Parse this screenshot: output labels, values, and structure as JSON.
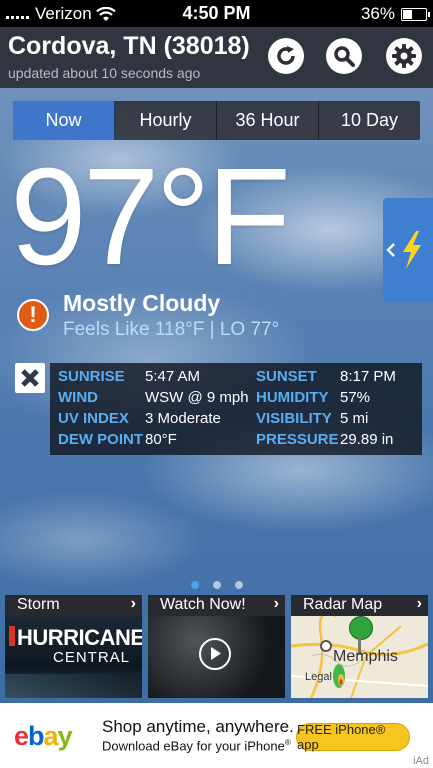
{
  "status_bar": {
    "carrier": "Verizon",
    "time": "4:50 PM",
    "battery": "36%",
    "battery_level": 0.36
  },
  "header": {
    "city": "Cordova, TN (38018)",
    "updated": "updated about 10 seconds ago",
    "buttons": [
      "refresh-icon",
      "search-icon",
      "gear-icon"
    ]
  },
  "tabs": [
    "Now",
    "Hourly",
    "36 Hour",
    "10 Day"
  ],
  "active_tab": "Now",
  "current": {
    "temp": "97°F",
    "condition": "Mostly Cloudy",
    "feels_like": "Feels Like 118°F |  LO 77°"
  },
  "details": {
    "sunrise_label": "SUNRISE",
    "sunrise": "5:47 AM",
    "sunset_label": "SUNSET",
    "sunset": "8:17 PM",
    "wind_label": "WIND",
    "wind": "WSW @ 9 mph",
    "humidity_label": "HUMIDITY",
    "humidity": "57%",
    "uv_label": "UV INDEX",
    "uv": "3 Moderate",
    "visibility_label": "VISIBILITY",
    "visibility": "5 mi",
    "dew_label": "DEW POINT",
    "dew": "80°F",
    "pressure_label": "PRESSURE",
    "pressure": "29.89 in"
  },
  "pager": {
    "pages": 3,
    "active": 0
  },
  "cards": {
    "storm": {
      "title": "Storm",
      "line1": "HURRICANE",
      "line2": "CENTRAL"
    },
    "watch": {
      "title": "Watch Now!"
    },
    "radar": {
      "title": "Radar Map",
      "city": "Memphis",
      "legal": "Legal"
    }
  },
  "ad": {
    "brand": "ebay",
    "headline": "Shop anytime, anywhere.",
    "sub": "Download eBay for your iPhone",
    "cta": "FREE iPhone® app",
    "tag": "iAd"
  },
  "colors": {
    "accent": "#3f76cc",
    "label_blue": "#58aef1",
    "alert_orange": "#e05b16",
    "alert_tab": "#3f7fd0",
    "cta_yellow": "#f7c51e"
  }
}
